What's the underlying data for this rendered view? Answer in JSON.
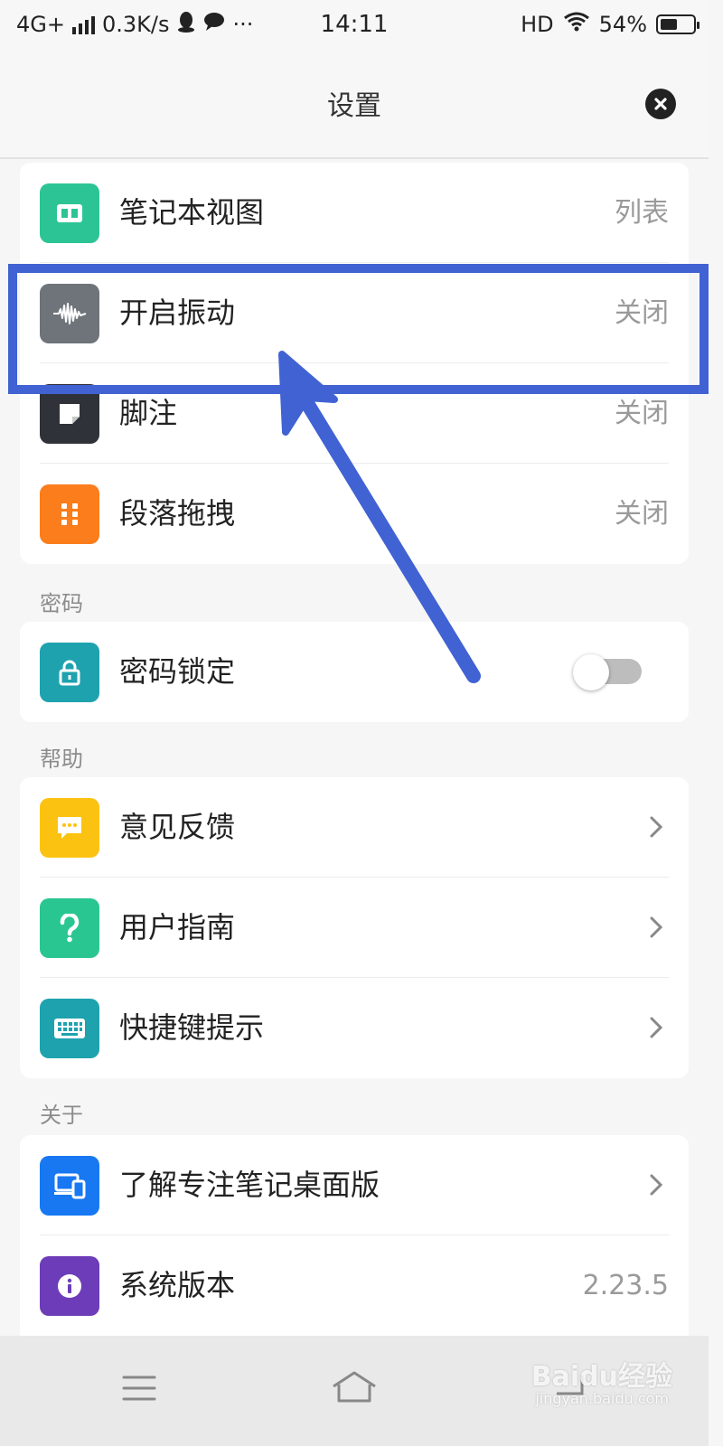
{
  "status_bar": {
    "network": "4G+",
    "speed": "0.3K/s",
    "more": "···",
    "time": "14:11",
    "hd": "HD",
    "battery": "54%",
    "battery_level": 0.54
  },
  "header": {
    "title": "设置"
  },
  "groups": [
    {
      "section": "",
      "rows": [
        {
          "label": "笔记本视图",
          "value": "列表",
          "icon": "columns-icon",
          "icon_color": "#2cc495"
        },
        {
          "label": "开启振动",
          "value": "关闭",
          "icon": "waveform-icon",
          "icon_color": "#6e7479"
        },
        {
          "label": "脚注",
          "value": "关闭",
          "icon": "note-icon",
          "icon_color": "#2f3238"
        },
        {
          "label": "段落拖拽",
          "value": "关闭",
          "icon": "grip-icon",
          "icon_color": "#fb7d1b"
        }
      ]
    },
    {
      "section": "密码",
      "rows": [
        {
          "label": "密码锁定",
          "toggle": false,
          "icon": "lock-icon",
          "icon_color": "#1ea2ae"
        }
      ]
    },
    {
      "section": "帮助",
      "rows": [
        {
          "label": "意见反馈",
          "icon": "chat-icon",
          "icon_color": "#fcc212"
        },
        {
          "label": "用户指南",
          "icon": "question-icon",
          "icon_color": "#2ac691"
        },
        {
          "label": "快捷键提示",
          "icon": "keyboard-icon",
          "icon_color": "#1ea2ae"
        }
      ]
    },
    {
      "section": "关于",
      "rows": [
        {
          "label": "了解专注笔记桌面版",
          "icon": "devices-icon",
          "icon_color": "#1778f2"
        },
        {
          "label": "系统版本",
          "value": "2.23.5",
          "icon": "info-icon",
          "icon_color": "#6d3cb8"
        }
      ]
    }
  ],
  "annotation": {
    "color": "#4162d3"
  },
  "watermark": {
    "text": "Baidu经验",
    "sub": "jingyan.baidu.com"
  }
}
